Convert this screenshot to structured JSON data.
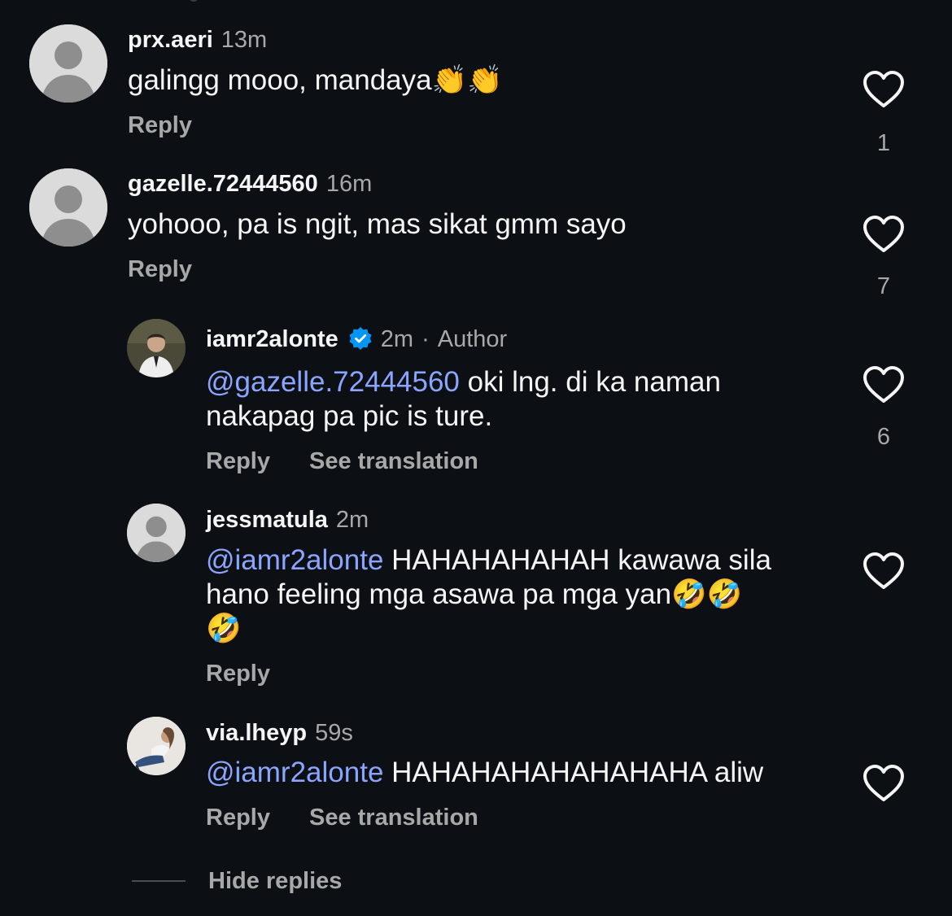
{
  "comments": [
    {
      "username": "prx.aeri",
      "time": "13m",
      "text": "galingg mooo, mandaya",
      "emoji": "👏👏",
      "reply_label": "Reply",
      "like_count": "1",
      "avatar_icon": "default-avatar-icon"
    },
    {
      "username": "gazelle.72444560",
      "time": "16m",
      "text": "yohooo, pa is ngit, mas sikat gmm sayo",
      "reply_label": "Reply",
      "like_count": "7",
      "avatar_icon": "default-avatar-icon"
    }
  ],
  "replies": [
    {
      "username": "iamr2alonte",
      "verified": true,
      "time": "2m",
      "separator": "·",
      "author_label": "Author",
      "mention": "@gazelle.72444560",
      "text_line1": " oki lng. di ka naman",
      "text_line2": "nakapag pa pic is ture.",
      "reply_label": "Reply",
      "translation_label": "See translation",
      "like_count": "6"
    },
    {
      "username": "jessmatula",
      "time": "2m",
      "mention": "@iamr2alonte",
      "text_line1": " HAHAHAHAHAH kawawa sila",
      "text_line2": "hano feeling mga asawa pa mga yan",
      "emoji_line2": "🤣🤣",
      "emoji_line3": "🤣",
      "reply_label": "Reply",
      "avatar_icon": "default-avatar-icon"
    },
    {
      "username": "via.lheyp",
      "time": "59s",
      "mention": "@iamr2alonte",
      "text_line1": " HAHAHAHAHAHAHAHA aliw",
      "reply_label": "Reply",
      "translation_label": "See translation"
    }
  ],
  "hide_replies_label": "Hide replies",
  "colors": {
    "background": "#0c1014",
    "mention": "#8ba5ff",
    "secondary_text": "#a8a8a8",
    "verified_badge": "#0095f6"
  }
}
